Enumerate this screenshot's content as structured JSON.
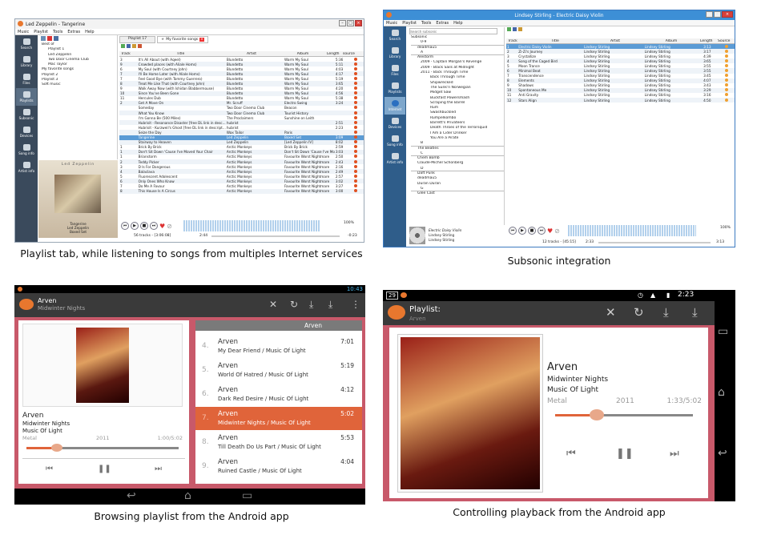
{
  "captions": {
    "tl": "Playlist tab, while listening to songs from multiples Internet services",
    "tr": "Subsonic integration",
    "bl": "Browsing playlist from the Android app",
    "br": "Controlling playback from the Android app"
  },
  "desk1": {
    "title": "Led Zeppelin - Tangerine",
    "menu": [
      "Music",
      "Playlist",
      "Tools",
      "Extras",
      "Help"
    ],
    "sidebar": [
      "Search",
      "Library",
      "Files",
      "Playlists",
      "Subsonic",
      "Devices",
      "Song info",
      "Artist info"
    ],
    "tree": [
      "Best of",
      "Playlist 1",
      "Led Zeppelin",
      "Two Door Cinema Club",
      "Mac Taylor",
      "My favorite songs",
      "Playlist 2",
      "Playlist 3",
      "Soft music"
    ],
    "tabs": [
      "Playlist 17",
      "My favorite songs"
    ],
    "columns": [
      "Track",
      "Title",
      "Artist",
      "Album",
      "Length",
      "source"
    ],
    "rows": [
      [
        "3",
        "It's All About (with Aqeel)",
        "Blundetto",
        "Warm My Soul",
        "5:36"
      ],
      [
        "9",
        "Crowded places (with Aliale Homs)",
        "Blundetto",
        "Warm My Soul",
        "5:11"
      ],
      [
        "6",
        "My Soul (with Courtney John)",
        "Blundetto",
        "Warm My Soul",
        "4:03"
      ],
      [
        "7",
        "I'll Be Home Later (with Aliale Homs)",
        "Blundetto",
        "Warm My Soul",
        "4:17"
      ],
      [
        "7",
        "Feel Good Bye (with Tommy Guerrero)",
        "Blundetto",
        "Warm My Soul",
        "5:19"
      ],
      [
        "8",
        "Treat Me Like That (with Courtney John)",
        "Blundetto",
        "Warm My Soul",
        "3:65"
      ],
      [
        "9",
        "Walk Away Now (with Ishidan Blabbermouse)",
        "Blundetto",
        "Warm My Soul",
        "4:20"
      ],
      [
        "10",
        "Since You've Been Gone",
        "Blundetto",
        "Warm My Soul",
        "4:56"
      ],
      [
        "11",
        "Hercules Dub",
        "Blundetto",
        "Warm My Soul",
        "5:38"
      ],
      [
        "2",
        "Get A Move On",
        "Mr. Scruff",
        "Electro Swing",
        "3:24"
      ],
      [
        "",
        "Someday",
        "Two Door Cinema Club",
        "Beacon",
        ""
      ],
      [
        "",
        "What You Know",
        "Two Door Cinema Club",
        "Tourist History",
        ""
      ],
      [
        "",
        "I'm Gonna Be (500 Miles)",
        "The Proclaimers",
        "Sunshine on Leith",
        ""
      ],
      [
        "",
        "Hubrisit - Resonance Disaster [free DL link in desc...",
        "hubrist",
        "",
        "2:51"
      ],
      [
        "",
        "Hubrisit - Kurzweil's Ghost [free DL link in descript...",
        "hubrist",
        "",
        "2:23"
      ],
      [
        "",
        "Seize the Day",
        "Wax Tailor",
        "Paris",
        ""
      ],
      [
        "",
        "Tangerine",
        "Led Zeppelin",
        "Boxed Set",
        "3:09"
      ],
      [
        "",
        "Stairway to Heaven",
        "Led Zeppelin",
        "[Led Zeppelin IV]",
        "8:02"
      ],
      [
        "1",
        "Brick By Brick",
        "Arctic Monkeys",
        "Brick By Brick",
        "2:59"
      ],
      [
        "1",
        "Don't Sit Down 'Cause I've Moved Your Chair",
        "Arctic Monkeys",
        "Don't Sit Down 'Cause I've Move...",
        "3:03"
      ],
      [
        "1",
        "Brianstorm",
        "Arctic Monkeys",
        "Favourite Worst Nightmare",
        "2:50"
      ],
      [
        "2",
        "Teddy Picker",
        "Arctic Monkeys",
        "Favourite Worst Nightmare",
        "2:43"
      ],
      [
        "3",
        "D Is For Dangerous",
        "Arctic Monkeys",
        "Favourite Worst Nightmare",
        "2:16"
      ],
      [
        "4",
        "Balaclava",
        "Arctic Monkeys",
        "Favourite Worst Nightmare",
        "2:49"
      ],
      [
        "5",
        "Fluorescent Adolescent",
        "Arctic Monkeys",
        "Favourite Worst Nightmare",
        "2:57"
      ],
      [
        "6",
        "Only Ones Who Know",
        "Arctic Monkeys",
        "Favourite Worst Nightmare",
        "3:02"
      ],
      [
        "7",
        "Do Me A Favour",
        "Arctic Monkeys",
        "Favourite Worst Nightmare",
        "3:27"
      ],
      [
        "8",
        "This House Is A Circus",
        "Arctic Monkeys",
        "Favourite Worst Nightmare",
        "3:00"
      ]
    ],
    "selected_row": 16,
    "art_title": "Led Zeppelin",
    "now_playing": [
      "Tangerine",
      "Led Zeppelin",
      "Boxed Set"
    ],
    "status": "56 tracks - [3:06:08]",
    "time_left": "2:44",
    "time_right": "-0:23",
    "volume": "100%"
  },
  "desk2": {
    "title": "Lindsey Stirling - Electric Daisy Violin",
    "menu": [
      "Music",
      "Playlist",
      "Tools",
      "Extras",
      "Help"
    ],
    "search_placeholder": "Search subsonic",
    "sidebar": [
      "Search",
      "Library",
      "Files",
      "Playlists",
      "Internet",
      "Devices",
      "Song info",
      "Artist info"
    ],
    "tree": [
      "Subsonic",
      "0-9",
      "deadmau5",
      "A",
      "Alestorm",
      "2009 - Captain Morgan's Revenge",
      "2009 - Black Sails at Midnight",
      "2011 - Back Through Time",
      "Back Through Time",
      "Shipwrecked",
      "The Sunk'n Norwegian",
      "Midget Saw",
      "Buckfast Powersmash",
      "Scraping the Barrel",
      "Rum",
      "Swashbuckled",
      "Rumpelkombo",
      "Barrett's Privateers",
      "Death Throes of the Terrorsquid",
      "I Am a Cider Drinker",
      "You Are a Pirate",
      "B",
      "The Beatles",
      "C",
      "Chem Bomb",
      "Claude-Michel Schönberg",
      "D",
      "Daft Punk",
      "deadmau5",
      "Duran Duran",
      "G",
      "Glee Cast"
    ],
    "columns": [
      "Track",
      "Title",
      "Artist",
      "Album",
      "Length",
      "Source"
    ],
    "rows": [
      [
        "1",
        "Electric Daisy Violin",
        "Lindsey Stirling",
        "Lindsey Stirling",
        "3:13"
      ],
      [
        "2",
        "Zi-Zi's Journey",
        "Lindsey Stirling",
        "Lindsey Stirling",
        "3:17"
      ],
      [
        "3",
        "Crystallize",
        "Lindsey Stirling",
        "Lindsey Stirling",
        "4:39"
      ],
      [
        "4",
        "Song of the Caged Bird",
        "Lindsey Stirling",
        "Lindsey Stirling",
        "3:65"
      ],
      [
        "5",
        "Moon Trance",
        "Lindsey Stirling",
        "Lindsey Stirling",
        "3:55"
      ],
      [
        "6",
        "Minimal Beat",
        "Lindsey Stirling",
        "Lindsey Stirling",
        "3:55"
      ],
      [
        "7",
        "Transcendence",
        "Lindsey Stirling",
        "Lindsey Stirling",
        "3:45"
      ],
      [
        "8",
        "Elements",
        "Lindsey Stirling",
        "Lindsey Stirling",
        "4:07"
      ],
      [
        "9",
        "Shadows",
        "Lindsey Stirling",
        "Lindsey Stirling",
        "3:43"
      ],
      [
        "10",
        "Spontaneous Me",
        "Lindsey Stirling",
        "Lindsey Stirling",
        "3:29"
      ],
      [
        "11",
        "Anti Gravity",
        "Lindsey Stirling",
        "Lindsey Stirling",
        "3:16"
      ],
      [
        "12",
        "Stars Align",
        "Lindsey Stirling",
        "Lindsey Stirling",
        "4:50"
      ]
    ],
    "now_playing": [
      "Electric Daisy Violin",
      "Lindsey Stirling",
      "Lindsey Stirling"
    ],
    "status": "12 tracks - [45:15]",
    "time_left": "2:33",
    "time_right": "3:13",
    "volume": "100%"
  },
  "phone1": {
    "clock": "10:43",
    "artist": "Arven",
    "album": "Midwinter Nights",
    "list_header": "Arven",
    "song_title": "Arven",
    "song_sub1": "Midwinter Nights",
    "song_sub2": "Music Of Light",
    "genre": "Metal",
    "year": "2011",
    "time": "1:00/5:02",
    "progress": 0.2,
    "tracks": [
      {
        "n": "4.",
        "t": "Arven",
        "s": "My Dear Friend / Music Of Light",
        "d": "7:01"
      },
      {
        "n": "5.",
        "t": "Arven",
        "s": "World Of Hatred / Music Of Light",
        "d": "5:19"
      },
      {
        "n": "6.",
        "t": "Arven",
        "s": "Dark Red Desire / Music Of Light",
        "d": "4:12"
      },
      {
        "n": "7.",
        "t": "Arven",
        "s": "Midwinter Nights / Music Of Light",
        "d": "5:02"
      },
      {
        "n": "8.",
        "t": "Arven",
        "s": "Till Death Do Us Part / Music Of Light",
        "d": "5:53"
      },
      {
        "n": "9.",
        "t": "Arven",
        "s": "Ruined Castle / Music Of Light",
        "d": "4:04"
      }
    ],
    "selected": 3
  },
  "phone2": {
    "badge": "29",
    "clock": "2:23",
    "header_title": "Playlist:",
    "header_sub": "Arven",
    "song_title": "Arven",
    "song_sub1": "Midwinter Nights",
    "song_sub2": "Music Of Light",
    "genre": "Metal",
    "year": "2011",
    "time": "1:33/5:02",
    "progress": 0.3
  },
  "colors": {
    "accent": "#e0643a",
    "android_bar": "#3a3a3a",
    "win_side": "#3a4a5c",
    "subsonic_side": "#2f5d8a"
  }
}
